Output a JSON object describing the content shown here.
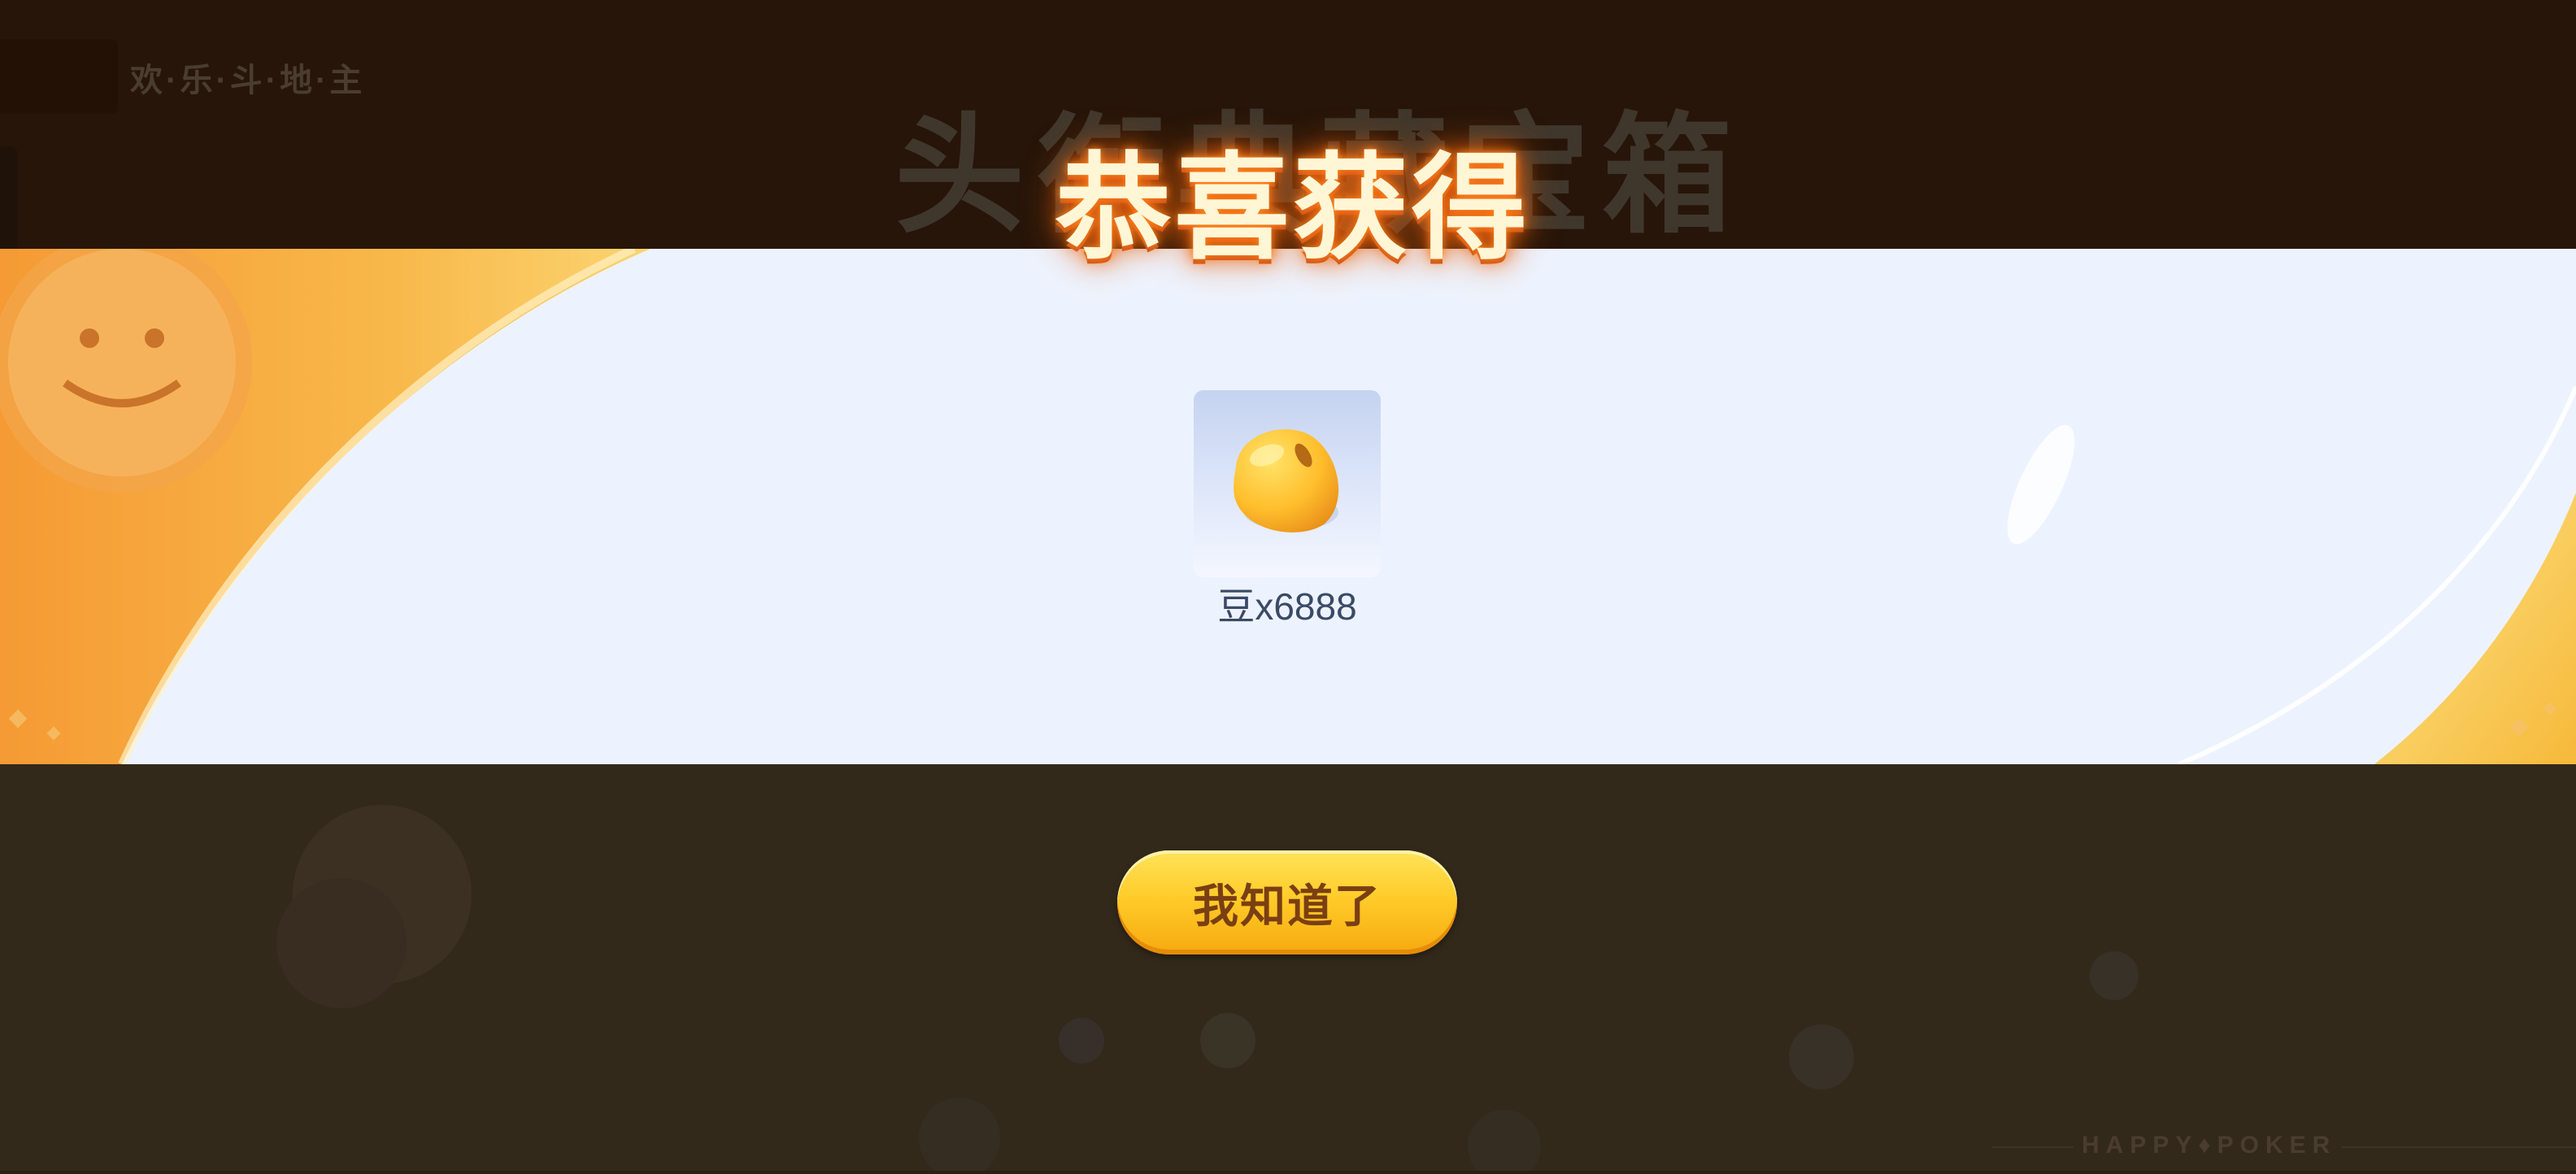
{
  "header": {
    "brand": "欢·乐·斗·地·主",
    "chest_title": "头衔典藏宝箱"
  },
  "reward_popup": {
    "title": "恭喜获得",
    "items": [
      {
        "icon": "bean-icon",
        "label": "豆x6888"
      }
    ],
    "confirm_label": "我知道了"
  },
  "footer": {
    "logo": "HAPPY♦POKER"
  },
  "colors": {
    "overlay_top": "#271509",
    "overlay_bottom": "#33291b",
    "banner": "#edf3fe",
    "accent_orange": "#f5a53a",
    "button_yellow": "#ffcc2a",
    "button_text": "#7a3f12",
    "title_glow": "#f05a0c"
  }
}
